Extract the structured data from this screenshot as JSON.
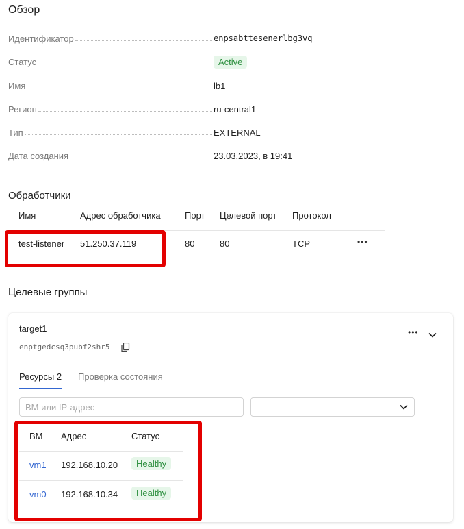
{
  "overview": {
    "title": "Обзор",
    "rows": [
      {
        "key": "Идентификатор",
        "value": "enpsabttesenerlbg3vq"
      },
      {
        "key": "Статус",
        "value": "Active"
      },
      {
        "key": "Имя",
        "value": "lb1"
      },
      {
        "key": "Регион",
        "value": "ru-central1"
      },
      {
        "key": "Тип",
        "value": "EXTERNAL"
      },
      {
        "key": "Дата создания",
        "value": "23.03.2023, в 19:41"
      }
    ]
  },
  "listeners": {
    "title": "Обработчики",
    "headers": {
      "name": "Имя",
      "address": "Адрес обработчика",
      "port": "Порт",
      "target_port": "Целевой порт",
      "protocol": "Протокол"
    },
    "rows": [
      {
        "name": "test-listener",
        "address": "51.250.37.119",
        "port": "80",
        "target_port": "80",
        "protocol": "TCP",
        "menu": "•••"
      }
    ]
  },
  "target_groups": {
    "title": "Целевые группы",
    "group": {
      "name": "target1",
      "id": "enptgedcsq3pubf2shr5",
      "menu": "•••",
      "tabs": [
        {
          "label": "Ресурсы 2",
          "active": true
        },
        {
          "label": "Проверка состояния",
          "active": false
        }
      ],
      "filter": {
        "placeholder": "ВМ или IP-адрес",
        "select_value": "—"
      },
      "table": {
        "headers": {
          "vm": "ВМ",
          "address": "Адрес",
          "status": "Статус"
        },
        "rows": [
          {
            "vm": "vm1",
            "address": "192.168.10.20",
            "status": "Healthy"
          },
          {
            "vm": "vm0",
            "address": "192.168.10.34",
            "status": "Healthy"
          }
        ]
      }
    }
  },
  "colors": {
    "highlight": "#e30000",
    "link": "#3467d1",
    "healthy_bg": "#e6f6e9",
    "healthy_text": "#2d8f3f",
    "tab_accent": "#3467d1"
  }
}
